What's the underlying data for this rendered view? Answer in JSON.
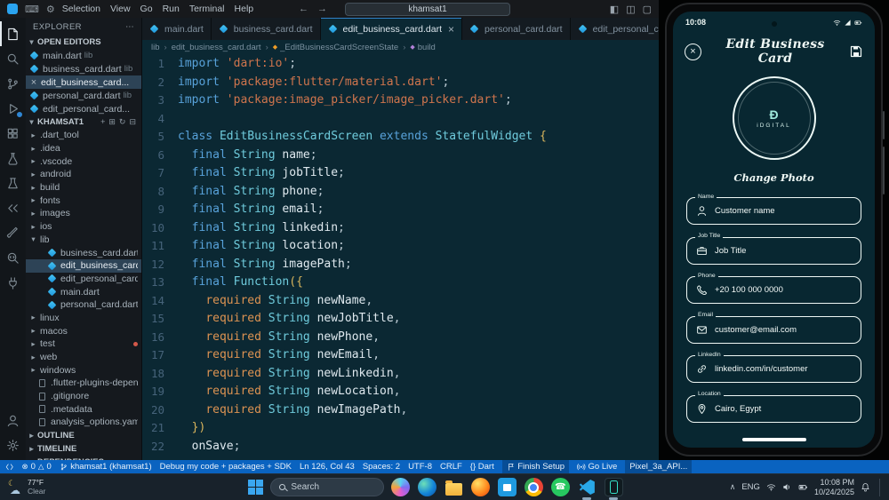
{
  "window": {
    "menus": [
      "Selection",
      "View",
      "Go",
      "Run",
      "Terminal",
      "Help"
    ],
    "search_value": "khamsat1"
  },
  "activitybar": {
    "top": [
      {
        "name": "explorer",
        "active": true
      },
      {
        "name": "search"
      },
      {
        "name": "source-control"
      },
      {
        "name": "run-debug",
        "badge": true
      },
      {
        "name": "extensions"
      },
      {
        "name": "testing"
      },
      {
        "name": "science"
      },
      {
        "name": "remote"
      },
      {
        "name": "paint"
      },
      {
        "name": "search-code"
      },
      {
        "name": "plug"
      }
    ],
    "bottom": [
      {
        "name": "account"
      },
      {
        "name": "settings"
      }
    ]
  },
  "sidebar": {
    "title": "EXPLORER",
    "open_editors_label": "OPEN EDITORS",
    "open_editors": [
      {
        "label": "main.dart",
        "desc": "lib"
      },
      {
        "label": "business_card.dart",
        "desc": "lib"
      },
      {
        "label": "edit_business_card...",
        "desc": "",
        "active": true
      },
      {
        "label": "personal_card.dart",
        "desc": "lib"
      },
      {
        "label": "edit_personal_card...",
        "desc": ""
      }
    ],
    "project_label": "KHAMSAT1",
    "tree": [
      {
        "label": ".dart_tool",
        "type": "folder",
        "level": 1
      },
      {
        "label": ".idea",
        "type": "folder",
        "level": 1
      },
      {
        "label": ".vscode",
        "type": "folder",
        "level": 1
      },
      {
        "label": "android",
        "type": "folder",
        "level": 1
      },
      {
        "label": "build",
        "type": "folder",
        "level": 1
      },
      {
        "label": "fonts",
        "type": "folder",
        "level": 1
      },
      {
        "label": "images",
        "type": "folder",
        "level": 1
      },
      {
        "label": "ios",
        "type": "folder",
        "level": 1
      },
      {
        "label": "lib",
        "type": "folder-open",
        "level": 1
      },
      {
        "label": "business_card.dart",
        "type": "dart",
        "level": 2
      },
      {
        "label": "edit_business_card.dart",
        "type": "dart",
        "level": 2,
        "selected": true
      },
      {
        "label": "edit_personal_card.dart",
        "type": "dart",
        "level": 2
      },
      {
        "label": "main.dart",
        "type": "dart",
        "level": 2
      },
      {
        "label": "personal_card.dart",
        "type": "dart",
        "level": 2
      },
      {
        "label": "linux",
        "type": "folder",
        "level": 1
      },
      {
        "label": "macos",
        "type": "folder",
        "level": 1
      },
      {
        "label": "test",
        "type": "folder",
        "level": 1,
        "dot": true
      },
      {
        "label": "web",
        "type": "folder",
        "level": 1
      },
      {
        "label": "windows",
        "type": "folder",
        "level": 1
      },
      {
        "label": ".flutter-plugins-depende...",
        "type": "file",
        "level": 1
      },
      {
        "label": ".gitignore",
        "type": "file",
        "level": 1
      },
      {
        "label": ".metadata",
        "type": "file",
        "level": 1
      },
      {
        "label": "analysis_options.yaml",
        "type": "file",
        "level": 1
      }
    ],
    "sections": [
      "OUTLINE",
      "TIMELINE",
      "DEPENDENCIES"
    ]
  },
  "tabs": [
    {
      "label": "main.dart"
    },
    {
      "label": "business_card.dart"
    },
    {
      "label": "edit_business_card.dart",
      "active": true
    },
    {
      "label": "personal_card.dart"
    },
    {
      "label": "edit_personal_card.dart"
    }
  ],
  "breadcrumb": [
    "lib",
    "edit_business_card.dart",
    "_EditBusinessCardScreenState",
    "build"
  ],
  "code": {
    "lines": [
      {
        "n": 1,
        "t": [
          [
            "k",
            "import "
          ],
          [
            "s",
            "'dart:io'"
          ],
          [
            "p",
            ";"
          ]
        ]
      },
      {
        "n": 2,
        "t": [
          [
            "k",
            "import "
          ],
          [
            "s",
            "'package:flutter/material.dart'"
          ],
          [
            "p",
            ";"
          ]
        ]
      },
      {
        "n": 3,
        "t": [
          [
            "k",
            "import "
          ],
          [
            "s",
            "'package:image_picker/image_picker.dart'"
          ],
          [
            "p",
            ";"
          ]
        ]
      },
      {
        "n": 4,
        "t": []
      },
      {
        "n": 5,
        "t": [
          [
            "k",
            "class "
          ],
          [
            "t",
            "EditBusinessCardScreen "
          ],
          [
            "k",
            "extends "
          ],
          [
            "t",
            "StatefulWidget "
          ],
          [
            "b",
            "{"
          ]
        ]
      },
      {
        "n": 6,
        "t": [
          [
            "p",
            "  "
          ],
          [
            "k",
            "final "
          ],
          [
            "t",
            "String "
          ],
          [
            "i",
            "name"
          ],
          [
            "p",
            ";"
          ]
        ]
      },
      {
        "n": 7,
        "t": [
          [
            "p",
            "  "
          ],
          [
            "k",
            "final "
          ],
          [
            "t",
            "String "
          ],
          [
            "i",
            "jobTitle"
          ],
          [
            "p",
            ";"
          ]
        ]
      },
      {
        "n": 8,
        "t": [
          [
            "p",
            "  "
          ],
          [
            "k",
            "final "
          ],
          [
            "t",
            "String "
          ],
          [
            "i",
            "phone"
          ],
          [
            "p",
            ";"
          ]
        ]
      },
      {
        "n": 9,
        "t": [
          [
            "p",
            "  "
          ],
          [
            "k",
            "final "
          ],
          [
            "t",
            "String "
          ],
          [
            "i",
            "email"
          ],
          [
            "p",
            ";"
          ]
        ]
      },
      {
        "n": 10,
        "t": [
          [
            "p",
            "  "
          ],
          [
            "k",
            "final "
          ],
          [
            "t",
            "String "
          ],
          [
            "i",
            "linkedin"
          ],
          [
            "p",
            ";"
          ]
        ]
      },
      {
        "n": 11,
        "t": [
          [
            "p",
            "  "
          ],
          [
            "k",
            "final "
          ],
          [
            "t",
            "String "
          ],
          [
            "i",
            "location"
          ],
          [
            "p",
            ";"
          ]
        ]
      },
      {
        "n": 12,
        "t": [
          [
            "p",
            "  "
          ],
          [
            "k",
            "final "
          ],
          [
            "t",
            "String "
          ],
          [
            "i",
            "imagePath"
          ],
          [
            "p",
            ";"
          ]
        ]
      },
      {
        "n": 13,
        "t": [
          [
            "p",
            "  "
          ],
          [
            "k",
            "final "
          ],
          [
            "t",
            "Function"
          ],
          [
            "b",
            "({"
          ]
        ]
      },
      {
        "n": 14,
        "t": [
          [
            "p",
            "    "
          ],
          [
            "r",
            "required "
          ],
          [
            "t",
            "String "
          ],
          [
            "i",
            "newName"
          ],
          [
            "p",
            ","
          ]
        ]
      },
      {
        "n": 15,
        "t": [
          [
            "p",
            "    "
          ],
          [
            "r",
            "required "
          ],
          [
            "t",
            "String "
          ],
          [
            "i",
            "newJobTitle"
          ],
          [
            "p",
            ","
          ]
        ]
      },
      {
        "n": 16,
        "t": [
          [
            "p",
            "    "
          ],
          [
            "r",
            "required "
          ],
          [
            "t",
            "String "
          ],
          [
            "i",
            "newPhone"
          ],
          [
            "p",
            ","
          ]
        ]
      },
      {
        "n": 17,
        "t": [
          [
            "p",
            "    "
          ],
          [
            "r",
            "required "
          ],
          [
            "t",
            "String "
          ],
          [
            "i",
            "newEmail"
          ],
          [
            "p",
            ","
          ]
        ]
      },
      {
        "n": 18,
        "t": [
          [
            "p",
            "    "
          ],
          [
            "r",
            "required "
          ],
          [
            "t",
            "String "
          ],
          [
            "i",
            "newLinkedin"
          ],
          [
            "p",
            ","
          ]
        ]
      },
      {
        "n": 19,
        "t": [
          [
            "p",
            "    "
          ],
          [
            "r",
            "required "
          ],
          [
            "t",
            "String "
          ],
          [
            "i",
            "newLocation"
          ],
          [
            "p",
            ","
          ]
        ]
      },
      {
        "n": 20,
        "t": [
          [
            "p",
            "    "
          ],
          [
            "r",
            "required "
          ],
          [
            "t",
            "String "
          ],
          [
            "i",
            "newImagePath"
          ],
          [
            "p",
            ","
          ]
        ]
      },
      {
        "n": 21,
        "t": [
          [
            "p",
            "  "
          ],
          [
            "b",
            "})"
          ]
        ]
      },
      {
        "n": 22,
        "t": [
          [
            "p",
            "  "
          ],
          [
            "i",
            "onSave"
          ],
          [
            "p",
            ";"
          ]
        ]
      }
    ]
  },
  "emulator": {
    "status_time": "10:08",
    "title": "Edit Business Card",
    "logo_mark": "Đ",
    "logo_text": "iDGITAL",
    "caption": "Change Photo",
    "fields": [
      {
        "label": "Name",
        "icon": "person",
        "value": "Customer name"
      },
      {
        "label": "Job Title",
        "icon": "briefcase",
        "value": "Job Title"
      },
      {
        "label": "Phone",
        "icon": "phone",
        "value": "+20 100 000 0000"
      },
      {
        "label": "Email",
        "icon": "email",
        "value": "customer@email.com"
      },
      {
        "label": "LinkedIn",
        "icon": "link",
        "value": "linkedin.com/in/customer"
      },
      {
        "label": "Location",
        "icon": "location",
        "value": "Cairo, Egypt"
      }
    ]
  },
  "statusbar": {
    "errors": "0",
    "warnings": "0",
    "branch": "khamsat1 (khamsat1)",
    "message": "Debug my code + packages + SDK",
    "line_col": "Ln 126, Col 43",
    "spaces": "Spaces: 2",
    "encoding": "UTF-8",
    "eol": "CRLF",
    "language": "{} Dart",
    "finish_setup": "Finish Setup",
    "go_live": "Go Live",
    "device": "Pixel_3a_API..."
  },
  "taskbar": {
    "weather_temp": "77°F",
    "weather_desc": "Clear",
    "search_label": "Search",
    "apps": [
      {
        "name": "copilot"
      },
      {
        "name": "edge"
      },
      {
        "name": "folder"
      },
      {
        "name": "firefox"
      },
      {
        "name": "store"
      },
      {
        "name": "chrome"
      },
      {
        "name": "whatsapp"
      },
      {
        "name": "vscode",
        "active": true
      },
      {
        "name": "emulator",
        "active": true
      }
    ],
    "tray_lang": "ENG",
    "time": "10:08 PM",
    "date": "10/24/2025"
  },
  "colors": {
    "statusbar_blue": "#0a63c0",
    "editor_bg": "#0b2833",
    "phone_screen_bg": "#082731",
    "accent_dart_blue": "#2aa3ef"
  }
}
